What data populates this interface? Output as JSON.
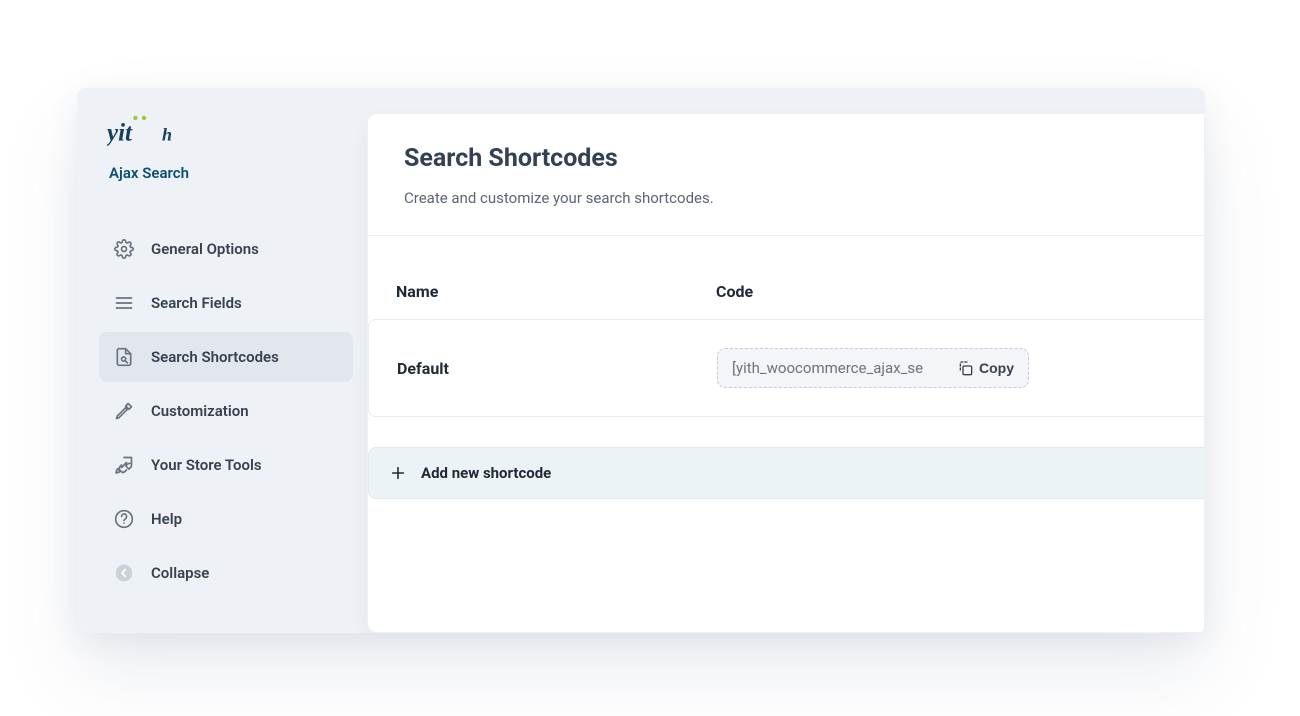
{
  "brand": {
    "sub": "Ajax Search"
  },
  "sidebar": {
    "items": [
      {
        "label": "General Options"
      },
      {
        "label": "Search Fields"
      },
      {
        "label": "Search Shortcodes"
      },
      {
        "label": "Customization"
      },
      {
        "label": "Your Store Tools"
      },
      {
        "label": "Help"
      },
      {
        "label": "Collapse"
      }
    ]
  },
  "panel": {
    "title": "Search Shortcodes",
    "subtitle": "Create and customize your search shortcodes."
  },
  "table": {
    "columns": {
      "name": "Name",
      "code": "Code"
    },
    "rows": [
      {
        "name": "Default",
        "code": "[yith_woocommerce_ajax_se",
        "copy_label": "Copy"
      }
    ]
  },
  "add_button": {
    "label": "Add new shortcode"
  }
}
